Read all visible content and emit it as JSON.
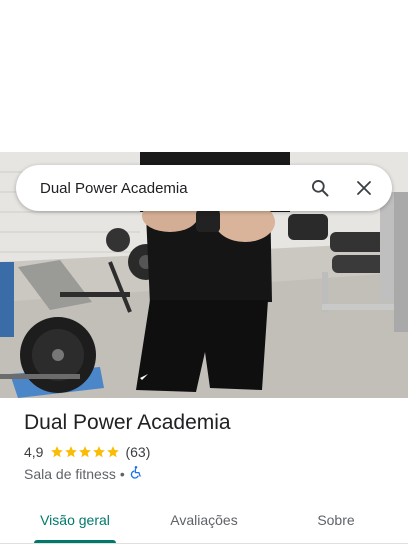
{
  "search": {
    "query": "Dual Power Academia"
  },
  "place": {
    "name": "Dual Power Academia",
    "rating": "4,9",
    "rating_stars": 5,
    "review_count": "(63)",
    "category": "Sala de fitness",
    "separator": "•",
    "accessibility": "wheelchair-icon"
  },
  "tabs": [
    {
      "label": "Visão geral",
      "active": true
    },
    {
      "label": "Avaliações",
      "active": false
    },
    {
      "label": "Sobre",
      "active": false
    }
  ],
  "colors": {
    "accent": "#00796b",
    "star": "#fbbc04",
    "accessibility": "#1a73e8"
  },
  "icons": {
    "search": "search-icon",
    "close": "close-icon",
    "star": "star-icon"
  }
}
